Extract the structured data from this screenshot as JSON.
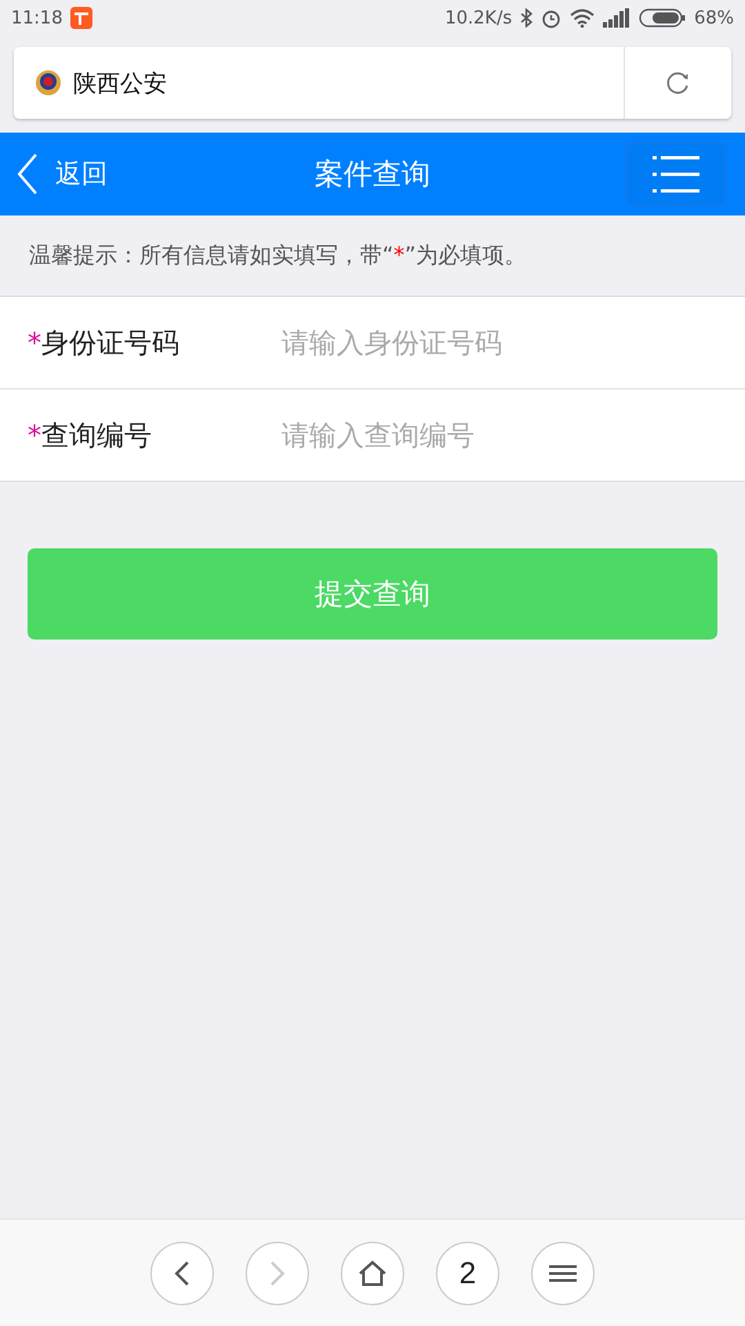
{
  "status_bar": {
    "time": "11:18",
    "speed": "10.2K/s",
    "battery": "68%"
  },
  "address_bar": {
    "site_title": "陕西公安"
  },
  "header": {
    "back_label": "返回",
    "title": "案件查询"
  },
  "notice": {
    "before": "温馨提示：所有信息请如实填写，带“",
    "mark": "*",
    "after": "”为必填项。"
  },
  "fields": [
    {
      "label": "身份证号码",
      "required": true,
      "placeholder": "请输入身份证号码"
    },
    {
      "label": "查询编号",
      "required": true,
      "placeholder": "请输入查询编号"
    }
  ],
  "submit_button": "提交查询",
  "browser_nav": [
    {
      "kind": "back",
      "disabled": false
    },
    {
      "kind": "forward",
      "disabled": true
    },
    {
      "kind": "home",
      "disabled": false
    },
    {
      "kind": "tabs",
      "label": "2",
      "disabled": false
    },
    {
      "kind": "menu",
      "disabled": false
    }
  ]
}
